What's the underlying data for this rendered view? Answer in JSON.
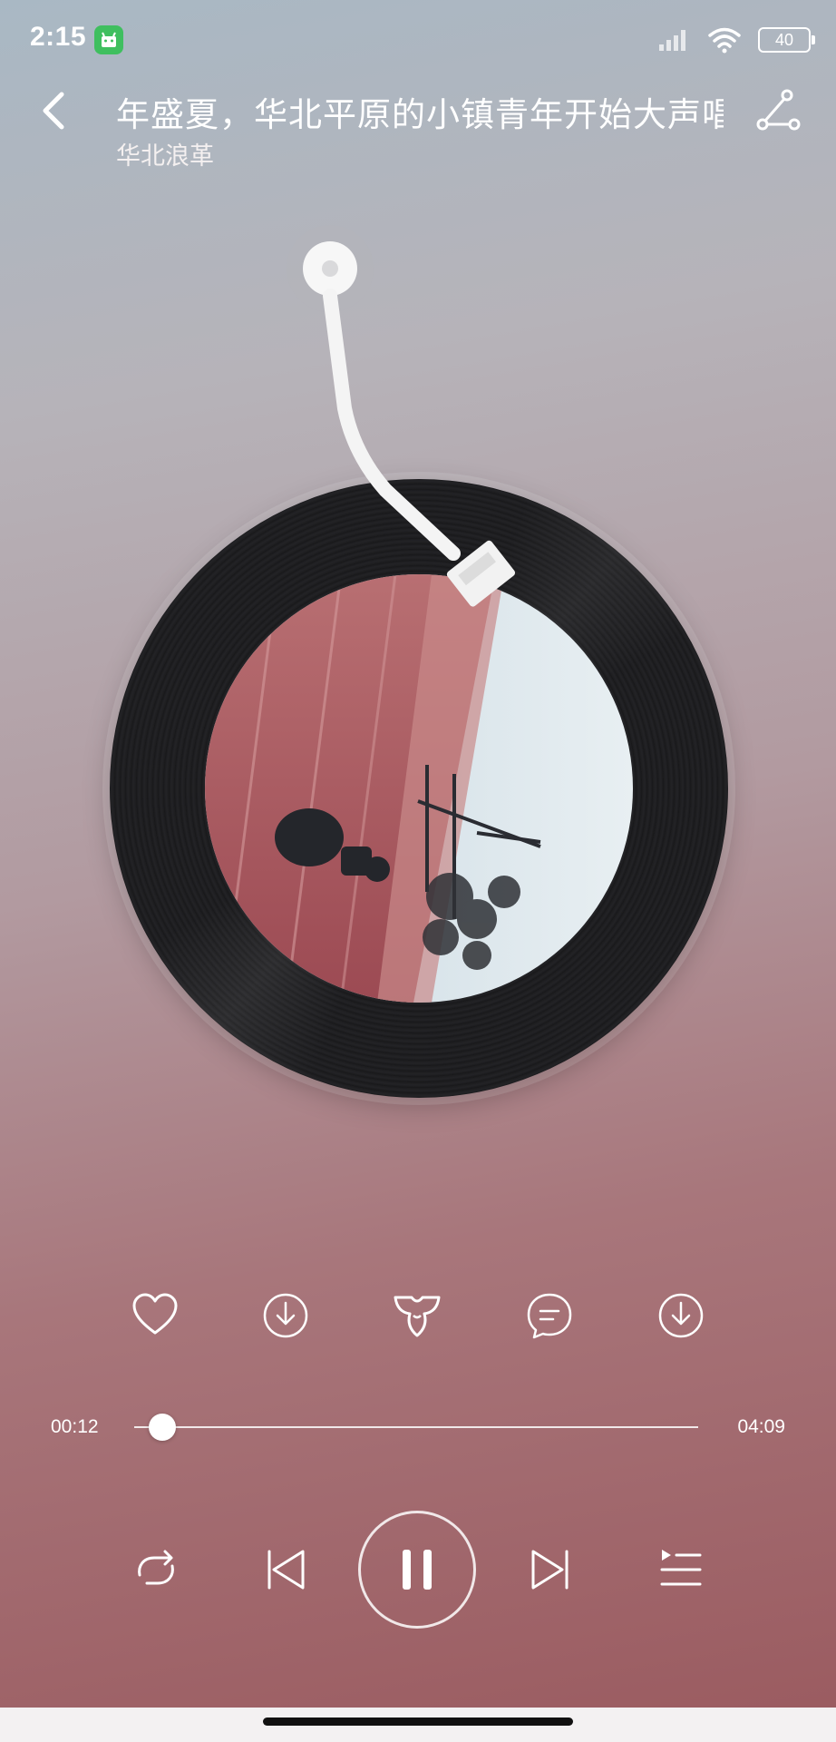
{
  "status_bar": {
    "time": "2:15",
    "battery": "40",
    "colors": {
      "android_badge": "#3fbf5f"
    }
  },
  "header": {
    "title": "年盛夏，华北平原的小镇青年开始大声唱",
    "artist": "华北浪革",
    "back_icon": "chevron-left-icon",
    "share_icon": "share-icon"
  },
  "record": {
    "cover_image": "album-cover-photo",
    "tonearm_icon": "tonearm-icon"
  },
  "actions": [
    {
      "name": "like-button",
      "icon": "heart-icon"
    },
    {
      "name": "download-button",
      "icon": "download-icon"
    },
    {
      "name": "sound-effect-button",
      "icon": "sound-effect-icon"
    },
    {
      "name": "comment-button",
      "icon": "comment-icon"
    },
    {
      "name": "more-download-button",
      "icon": "download-icon"
    }
  ],
  "progress": {
    "current": "00:12",
    "total": "04:09",
    "fraction": 0.05
  },
  "controls": {
    "repeat_icon": "repeat-icon",
    "prev_icon": "previous-icon",
    "pause_icon": "pause-icon",
    "next_icon": "next-icon",
    "playlist_icon": "playlist-icon"
  }
}
